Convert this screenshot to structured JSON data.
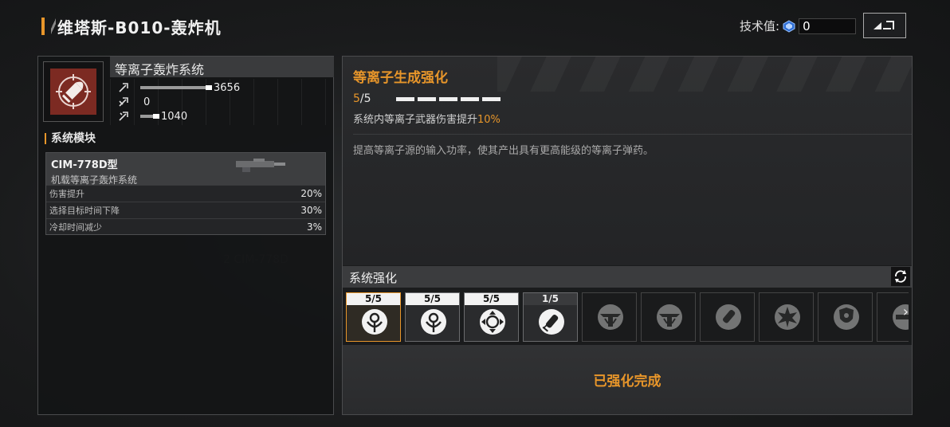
{
  "header": {
    "title": "维塔斯-B010-轰炸机",
    "tech_label": "技术值:",
    "tech_value": "0"
  },
  "system": {
    "name": "等离子轰炸系统",
    "stats": [
      {
        "icon": "damage-stat-icon",
        "value": "3656"
      },
      {
        "icon": "penetration-stat-icon",
        "value": "0"
      },
      {
        "icon": "range-stat-icon",
        "value": "1040"
      }
    ],
    "module_section_label": "系统模块",
    "module": {
      "name": "CIM-778D型",
      "sub": "机载等离子轰炸系统",
      "rows": [
        {
          "label": "伤害提升",
          "value": "20%"
        },
        {
          "label": "选择目标时间下降",
          "value": "30%"
        },
        {
          "label": "冷却时间减少",
          "value": "3%"
        }
      ]
    }
  },
  "detail": {
    "title": "等离子生成强化",
    "level_current": "5",
    "level_max": "/5",
    "effect_text": "系统内等离子武器伤害提升",
    "effect_pct": "10%",
    "description": "提高等离子源的输入功率，使其产出具有更高能级的等离子弹药。"
  },
  "enhance": {
    "header": "系统强化",
    "slots": [
      {
        "level": "5/5",
        "icon": "plasma-generator-icon",
        "state": "selected"
      },
      {
        "level": "5/5",
        "icon": "plasma-generator-icon",
        "state": "filled"
      },
      {
        "level": "5/5",
        "icon": "target-lock-icon",
        "state": "filled"
      },
      {
        "level": "1/5",
        "icon": "bomb-drop-icon",
        "state": "partial"
      },
      {
        "level": "",
        "icon": "wing-emblem-icon",
        "state": "locked"
      },
      {
        "level": "",
        "icon": "wing-emblem-icon",
        "state": "locked"
      },
      {
        "level": "",
        "icon": "bomb-drop-icon",
        "state": "locked"
      },
      {
        "level": "",
        "icon": "burst-icon",
        "state": "locked"
      },
      {
        "level": "",
        "icon": "shield-crest-icon",
        "state": "locked"
      },
      {
        "level": "",
        "icon": "cannon-icon",
        "state": "locked"
      }
    ],
    "complete_text": "已强化完成"
  },
  "colors": {
    "accent": "#e8962a",
    "system_icon_bg": "#7c2a22"
  }
}
